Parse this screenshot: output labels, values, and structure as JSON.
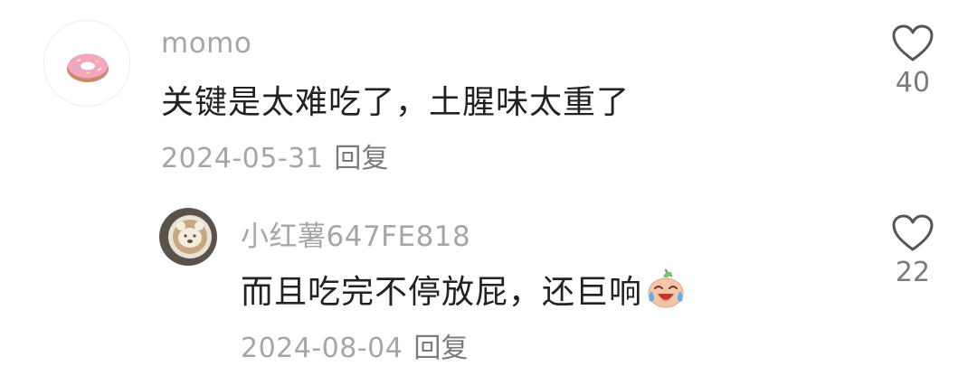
{
  "comments": [
    {
      "username": "momo",
      "text": "关键是太难吃了，土腥味太重了",
      "date": "2024-05-31",
      "reply_label": "回复",
      "like_count": "40",
      "avatar_icon": "donut-icon"
    },
    {
      "username": "小红薯647FE818",
      "text": "而且吃完不停放屁，还巨响",
      "emoji_icon": "crying-laughing-face-icon",
      "date": "2024-08-04",
      "reply_label": "回复",
      "like_count": "22",
      "avatar_icon": "latte-art-bear-icon"
    }
  ],
  "colors": {
    "muted_text": "#a6a6a6",
    "body_text": "#222222",
    "like_icon": "#555555"
  }
}
